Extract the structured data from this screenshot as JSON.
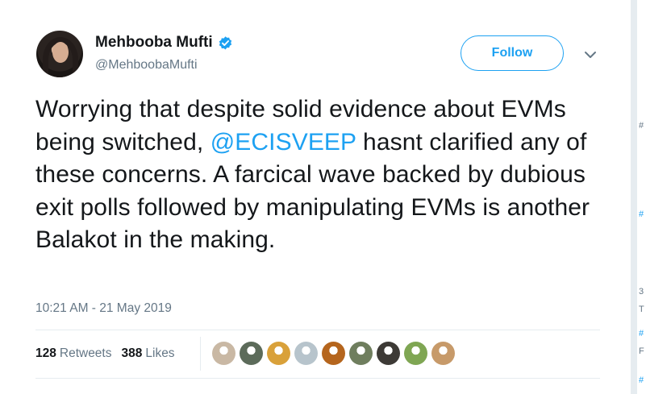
{
  "author": {
    "name": "Mehbooba Mufti",
    "handle": "@MehboobaMufti",
    "verified": true
  },
  "follow_button": {
    "label": "Follow"
  },
  "tweet": {
    "text_part1": "Worrying that despite solid evidence about EVMs being switched, ",
    "mention": "@ECISVEEP",
    "text_part2": " hasnt clarified any of these concerns. A farcical wave backed by dubious exit polls followed by manipulating EVMs is another Balakot in the making.",
    "timestamp": "10:21 AM - 21 May 2019"
  },
  "stats": {
    "retweets_count": "128",
    "retweets_label": "Retweets",
    "likes_count": "388",
    "likes_label": "Likes"
  },
  "colors": {
    "accent": "#1da1f2",
    "text": "#14171a",
    "muted": "#657786",
    "divider": "#e6ecf0"
  },
  "likers": [
    {
      "icon": "avatar-1",
      "color": "#c9b8a4"
    },
    {
      "icon": "avatar-2",
      "color": "#5c6b5a"
    },
    {
      "icon": "avatar-3",
      "color": "#d9a13a"
    },
    {
      "icon": "avatar-4",
      "color": "#b7c4cc"
    },
    {
      "icon": "avatar-5",
      "color": "#b5651d"
    },
    {
      "icon": "avatar-6",
      "color": "#6f7e5e"
    },
    {
      "icon": "avatar-7",
      "color": "#3d3a36"
    },
    {
      "icon": "avatar-8",
      "color": "#7fa653"
    },
    {
      "icon": "avatar-9",
      "color": "#c79a6a"
    }
  ],
  "sidebar_fragments": [
    "#",
    "#",
    "3",
    "T",
    "#",
    "F",
    "#"
  ]
}
